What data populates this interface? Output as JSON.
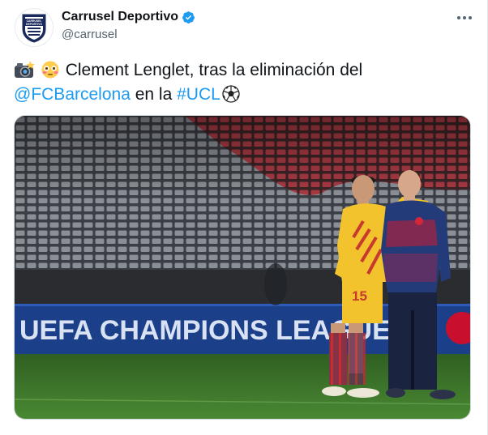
{
  "account": {
    "display_name": "Carrusel Deportivo",
    "handle": "@carrusel",
    "avatar_text": [
      "CARRUSEL",
      "DEPORTIVO"
    ],
    "verified": true
  },
  "tweet": {
    "emojis": [
      "camera-flash-emoji",
      "flushed-face-emoji"
    ],
    "text_part1": "Clement Lenglet, tras la eliminación del",
    "mention": "@FCBarcelona",
    "text_part2": "en la",
    "hashtag": "#UCL",
    "emoji_end": "soccer-ball-emoji"
  },
  "media": {
    "board_text": "UEFA CHAMPIONS LEAGUE",
    "shirt_number": "15"
  },
  "colors": {
    "link": "#1d9bf0",
    "verified": "#1d9bf0",
    "board": "#1c3f8a",
    "pitch": "#3f7a2c"
  }
}
